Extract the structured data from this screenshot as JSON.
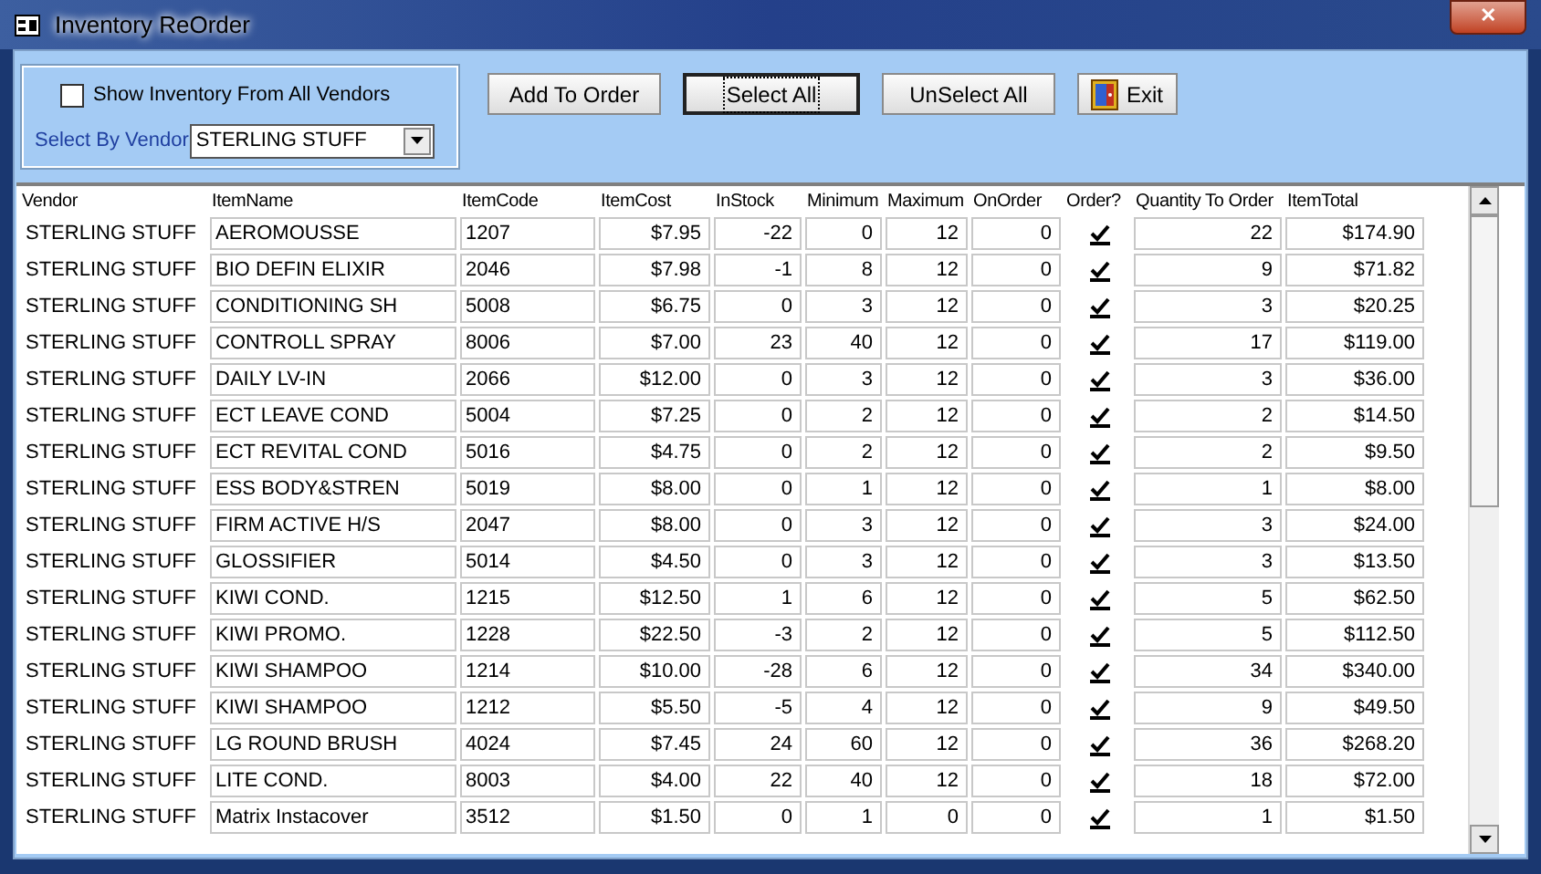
{
  "window": {
    "title": "Inventory ReOrder",
    "close_label": "✕"
  },
  "filter": {
    "show_all_vendors": {
      "label": "Show Inventory From All Vendors",
      "checked": false
    },
    "vendor_select": {
      "label": "Select By Vendor",
      "value": "STERLING STUFF"
    }
  },
  "buttons": [
    {
      "label": "Add To Order",
      "focused": false,
      "icon": false
    },
    {
      "label": "Select All",
      "focused": true,
      "icon": false
    },
    {
      "label": "UnSelect All",
      "focused": false,
      "icon": false
    },
    {
      "label": "Exit",
      "focused": false,
      "icon": true
    }
  ],
  "table": {
    "columns": [
      "Vendor",
      "ItemName",
      "ItemCode",
      "ItemCost",
      "InStock",
      "Minimum",
      "Maximum",
      "OnOrder",
      "Order?",
      "Quantity To Order",
      "ItemTotal"
    ],
    "rows": [
      {
        "vendor": "STERLING STUFF",
        "item_name": "AEROMOUSSE",
        "item_code": "1207",
        "item_cost": "$7.95",
        "in_stock": "-22",
        "minimum": "0",
        "maximum": "12",
        "on_order": "0",
        "order": true,
        "quantity_to_order": "22",
        "item_total": "$174.90"
      },
      {
        "vendor": "STERLING STUFF",
        "item_name": "BIO DEFIN ELIXIR",
        "item_code": "2046",
        "item_cost": "$7.98",
        "in_stock": "-1",
        "minimum": "8",
        "maximum": "12",
        "on_order": "0",
        "order": true,
        "quantity_to_order": "9",
        "item_total": "$71.82"
      },
      {
        "vendor": "STERLING STUFF",
        "item_name": "CONDITIONING SH",
        "item_code": "5008",
        "item_cost": "$6.75",
        "in_stock": "0",
        "minimum": "3",
        "maximum": "12",
        "on_order": "0",
        "order": true,
        "quantity_to_order": "3",
        "item_total": "$20.25"
      },
      {
        "vendor": "STERLING STUFF",
        "item_name": "CONTROLL SPRAY",
        "item_code": "8006",
        "item_cost": "$7.00",
        "in_stock": "23",
        "minimum": "40",
        "maximum": "12",
        "on_order": "0",
        "order": true,
        "quantity_to_order": "17",
        "item_total": "$119.00"
      },
      {
        "vendor": "STERLING STUFF",
        "item_name": "DAILY LV-IN",
        "item_code": "2066",
        "item_cost": "$12.00",
        "in_stock": "0",
        "minimum": "3",
        "maximum": "12",
        "on_order": "0",
        "order": true,
        "quantity_to_order": "3",
        "item_total": "$36.00"
      },
      {
        "vendor": "STERLING STUFF",
        "item_name": "ECT LEAVE COND",
        "item_code": "5004",
        "item_cost": "$7.25",
        "in_stock": "0",
        "minimum": "2",
        "maximum": "12",
        "on_order": "0",
        "order": true,
        "quantity_to_order": "2",
        "item_total": "$14.50"
      },
      {
        "vendor": "STERLING STUFF",
        "item_name": "ECT REVITAL COND",
        "item_code": "5016",
        "item_cost": "$4.75",
        "in_stock": "0",
        "minimum": "2",
        "maximum": "12",
        "on_order": "0",
        "order": true,
        "quantity_to_order": "2",
        "item_total": "$9.50"
      },
      {
        "vendor": "STERLING STUFF",
        "item_name": "ESS BODY&STREN",
        "item_code": "5019",
        "item_cost": "$8.00",
        "in_stock": "0",
        "minimum": "1",
        "maximum": "12",
        "on_order": "0",
        "order": true,
        "quantity_to_order": "1",
        "item_total": "$8.00"
      },
      {
        "vendor": "STERLING STUFF",
        "item_name": "FIRM ACTIVE H/S",
        "item_code": "2047",
        "item_cost": "$8.00",
        "in_stock": "0",
        "minimum": "3",
        "maximum": "12",
        "on_order": "0",
        "order": true,
        "quantity_to_order": "3",
        "item_total": "$24.00"
      },
      {
        "vendor": "STERLING STUFF",
        "item_name": "GLOSSIFIER",
        "item_code": "5014",
        "item_cost": "$4.50",
        "in_stock": "0",
        "minimum": "3",
        "maximum": "12",
        "on_order": "0",
        "order": true,
        "quantity_to_order": "3",
        "item_total": "$13.50"
      },
      {
        "vendor": "STERLING STUFF",
        "item_name": "KIWI COND.",
        "item_code": "1215",
        "item_cost": "$12.50",
        "in_stock": "1",
        "minimum": "6",
        "maximum": "12",
        "on_order": "0",
        "order": true,
        "quantity_to_order": "5",
        "item_total": "$62.50"
      },
      {
        "vendor": "STERLING STUFF",
        "item_name": "KIWI PROMO.",
        "item_code": "1228",
        "item_cost": "$22.50",
        "in_stock": "-3",
        "minimum": "2",
        "maximum": "12",
        "on_order": "0",
        "order": true,
        "quantity_to_order": "5",
        "item_total": "$112.50"
      },
      {
        "vendor": "STERLING STUFF",
        "item_name": "KIWI SHAMPOO",
        "item_code": "1214",
        "item_cost": "$10.00",
        "in_stock": "-28",
        "minimum": "6",
        "maximum": "12",
        "on_order": "0",
        "order": true,
        "quantity_to_order": "34",
        "item_total": "$340.00"
      },
      {
        "vendor": "STERLING STUFF",
        "item_name": "KIWI SHAMPOO",
        "item_code": "1212",
        "item_cost": "$5.50",
        "in_stock": "-5",
        "minimum": "4",
        "maximum": "12",
        "on_order": "0",
        "order": true,
        "quantity_to_order": "9",
        "item_total": "$49.50"
      },
      {
        "vendor": "STERLING STUFF",
        "item_name": "LG ROUND BRUSH",
        "item_code": "4024",
        "item_cost": "$7.45",
        "in_stock": "24",
        "minimum": "60",
        "maximum": "12",
        "on_order": "0",
        "order": true,
        "quantity_to_order": "36",
        "item_total": "$268.20"
      },
      {
        "vendor": "STERLING STUFF",
        "item_name": "LITE COND.",
        "item_code": "8003",
        "item_cost": "$4.00",
        "in_stock": "22",
        "minimum": "40",
        "maximum": "12",
        "on_order": "0",
        "order": true,
        "quantity_to_order": "18",
        "item_total": "$72.00"
      },
      {
        "vendor": "STERLING STUFF",
        "item_name": "Matrix Instacover",
        "item_code": "3512",
        "item_cost": "$1.50",
        "in_stock": "0",
        "minimum": "1",
        "maximum": "0",
        "on_order": "0",
        "order": true,
        "quantity_to_order": "1",
        "item_total": "$1.50"
      }
    ]
  }
}
